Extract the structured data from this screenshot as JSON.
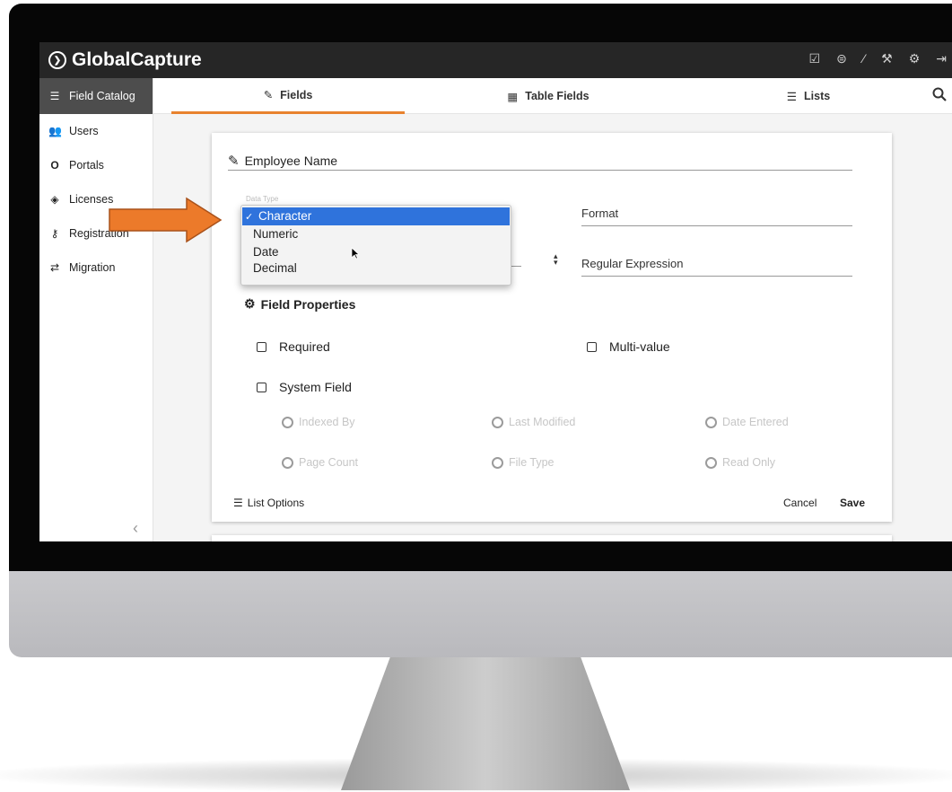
{
  "app": {
    "brand": "GlobalCapture"
  },
  "colors": {
    "accent": "#e8822e",
    "topbar": "#262626",
    "selection": "#2f73dc",
    "callout_arrow": "#ec7a2a"
  },
  "topbar_icons": [
    "clipboard-check-icon",
    "scanner-icon",
    "pen-icon",
    "wrench-icon",
    "gear-icon",
    "sign-out-icon"
  ],
  "sidebar": {
    "items": [
      {
        "label": "Field Catalog",
        "icon": "list-icon"
      },
      {
        "label": "Users",
        "icon": "users-icon"
      },
      {
        "label": "Portals",
        "icon": "portal-icon"
      },
      {
        "label": "Licenses",
        "icon": "tag-icon"
      },
      {
        "label": "Registration",
        "icon": "key-icon"
      },
      {
        "label": "Migration",
        "icon": "exchange-icon"
      }
    ]
  },
  "tabs": [
    {
      "label": "Fields",
      "icon": "edit-icon"
    },
    {
      "label": "Table Fields",
      "icon": "table-icon"
    },
    {
      "label": "Lists",
      "icon": "list-icon"
    }
  ],
  "form": {
    "field_name": "Employee Name",
    "data_type_label": "Data Type",
    "format_placeholder": "Format",
    "regex_placeholder": "Regular Expression",
    "data_type_options": [
      "Character",
      "Numeric",
      "Date",
      "Decimal"
    ],
    "selected_option": "Character",
    "properties_heading": "Field Properties",
    "checkboxes": {
      "required": "Required",
      "multi_value": "Multi-value",
      "system_field": "System Field"
    },
    "radios": {
      "indexed_by": "Indexed By",
      "last_modified": "Last Modified",
      "date_entered": "Date Entered",
      "page_count": "Page Count",
      "file_type": "File Type",
      "read_only": "Read Only"
    },
    "list_options": "List Options",
    "cancel": "Cancel",
    "save": "Save"
  }
}
